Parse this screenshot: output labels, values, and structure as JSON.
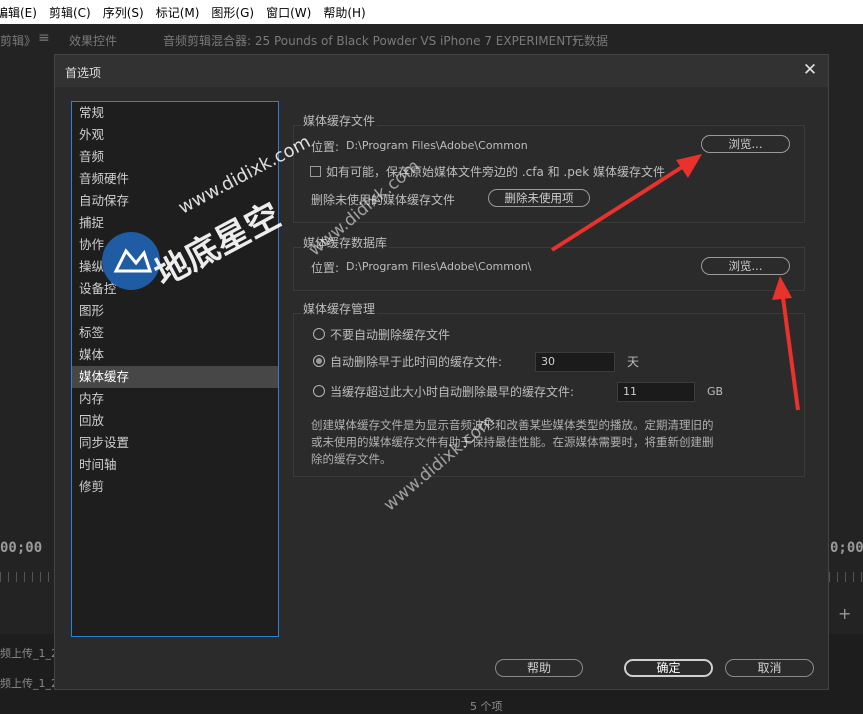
{
  "menu": [
    "编辑(E)",
    "剪辑(C)",
    "序列(S)",
    "标记(M)",
    "图形(G)",
    "窗口(W)",
    "帮助(H)"
  ],
  "tabs": {
    "left_partial": "剪辑》",
    "effect_controls": "效果控件",
    "audio_mixer": "音频剪辑混合器: 25 Pounds of Black Powder VS iPhone 7 EXPERIMENT!",
    "metadata": "元数据"
  },
  "background": {
    "timecode_left": "00;00",
    "timecode_right": "0;00",
    "bottom_text_1": "频上传_1_2",
    "bottom_text_2": "频上传_1_2",
    "items_count": "5 个项"
  },
  "dialog": {
    "title": "首选项",
    "sidebar": [
      "常规",
      "外观",
      "音频",
      "音频硬件",
      "自动保存",
      "捕捉",
      "协作",
      "操纵",
      "设备控",
      "图形",
      "标签",
      "媒体",
      "媒体缓存",
      "内存",
      "回放",
      "同步设置",
      "时间轴",
      "修剪"
    ],
    "selected_index": 12,
    "media_cache_files": {
      "label": "媒体缓存文件",
      "location_label": "位置:",
      "location_path": "D:\\Program Files\\Adobe\\Common",
      "browse": "浏览...",
      "checkbox_label": "如有可能，保存原始媒体文件旁边的 .cfa 和 .pek 媒体缓存文件",
      "checkbox_checked": false,
      "delete_unused_label": "删除未使用的媒体缓存文件",
      "delete_unused_button": "删除未使用项"
    },
    "media_cache_db": {
      "label": "媒体缓存数据库",
      "location_label": "位置:",
      "location_path": "D:\\Program Files\\Adobe\\Common\\",
      "browse": "浏览..."
    },
    "media_cache_management": {
      "label": "媒体缓存管理",
      "option1": "不要自动删除缓存文件",
      "option2": "自动删除早于此时间的缓存文件:",
      "option2_value": "30",
      "option2_unit": "天",
      "option3": "当缓存超过此大小时自动删除最早的缓存文件:",
      "option3_value": "11",
      "option3_unit": "GB",
      "selected_option": 2,
      "description": "创建媒体缓存文件是为显示音频波形和改善某些媒体类型的播放。定期清理旧的或未使用的媒体缓存文件有助于保持最佳性能。在源媒体需要时，将重新创建删除的缓存文件。"
    },
    "buttons": {
      "help": "帮助",
      "ok": "确定",
      "cancel": "取消"
    }
  },
  "watermark": {
    "logo_text": "地底星空",
    "url": "www.didixk.com"
  },
  "colors": {
    "accent_border": "#2d7fd2",
    "arrow": "#e8322b",
    "selected_row": "#474747"
  }
}
